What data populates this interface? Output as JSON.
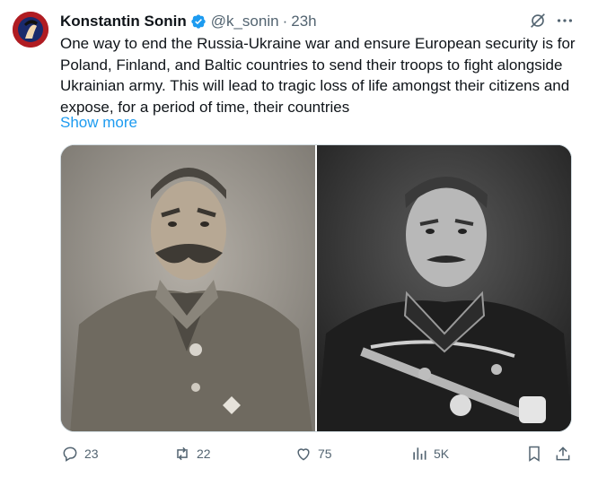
{
  "author": {
    "name": "Konstantin Sonin",
    "handle": "@k_sonin",
    "separator": "·",
    "time": "23h",
    "verified": true
  },
  "tweet": {
    "text": "One way to end the Russia-Ukraine war and ensure European security is for Poland, Finland, and Baltic countries to send their troops to fight alongside Ukrainian army. This will lead to tragic loss of life amongst their citizens and expose, for a period of time, their countries",
    "show_more": "Show more"
  },
  "media": {
    "photos": [
      {
        "icon": "portrait-photo-mustached-officer-sepia"
      },
      {
        "icon": "portrait-photo-officer-uniform-bw"
      }
    ]
  },
  "actions": {
    "replies": "23",
    "reposts": "22",
    "likes": "75",
    "views": "5K"
  },
  "colors": {
    "accent": "#1d9bf0",
    "muted": "#536471",
    "text": "#0f1419"
  }
}
